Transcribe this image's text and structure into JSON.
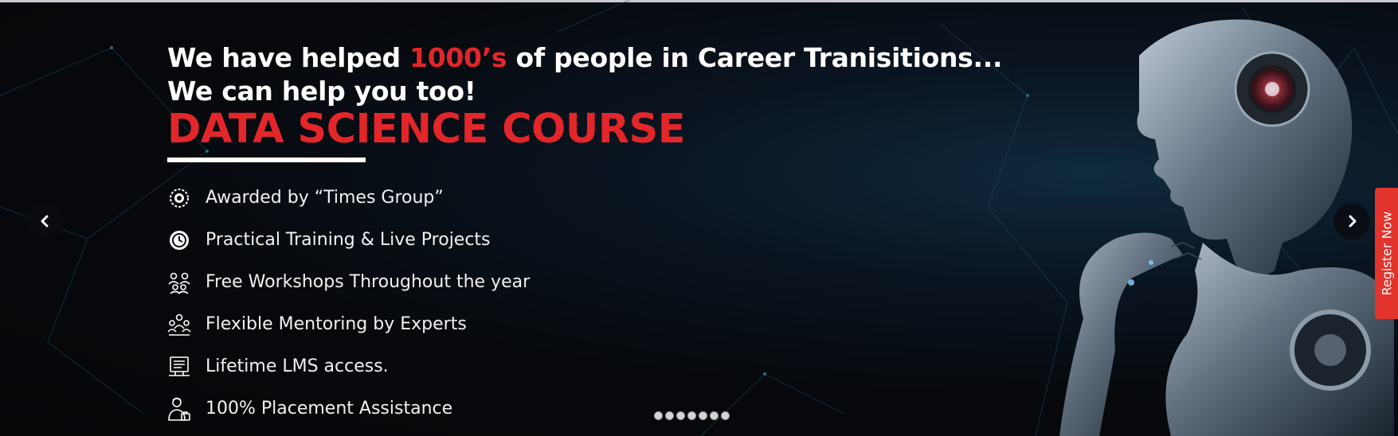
{
  "headline": {
    "line1_before": "We have helped ",
    "line1_highlight": "1000’s",
    "line1_after": " of people in Career Tranisitions...",
    "line2": "We can help you too!"
  },
  "course_title": "DATA SCIENCE COURSE",
  "features": [
    {
      "icon": "award-badge-icon",
      "text": "Awarded by “Times Group”"
    },
    {
      "icon": "clock-icon",
      "text": "Practical Training & Live Projects"
    },
    {
      "icon": "workshop-people-icon",
      "text": "Free Workshops Throughout the year"
    },
    {
      "icon": "mentoring-group-icon",
      "text": "Flexible Mentoring by Experts"
    },
    {
      "icon": "lms-screen-icon",
      "text": "Lifetime LMS  access."
    },
    {
      "icon": "placement-person-icon",
      "text": "100% Placement Assistance"
    }
  ],
  "slider": {
    "dot_count": 7,
    "prev_icon": "chevron-left-icon",
    "next_icon": "chevron-right-icon"
  },
  "register_tab": "Register Now",
  "colors": {
    "accent_red": "#e3262a",
    "register_red": "#e2342c",
    "background": "#07090d",
    "text": "#ffffff"
  }
}
